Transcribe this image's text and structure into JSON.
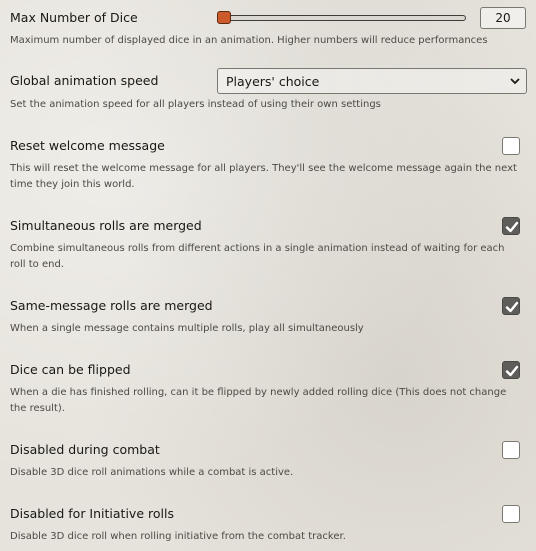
{
  "settings": [
    {
      "label": "Max Number of Dice",
      "hint": "Maximum number of displayed dice in an animation. Higher numbers will reduce performances",
      "control": "range",
      "value": "20"
    },
    {
      "label": "Global animation speed",
      "hint": "Set the animation speed for all players instead of using their own settings",
      "control": "select",
      "selected": "Players' choice"
    },
    {
      "label": "Reset welcome message",
      "hint": "This will reset the welcome message for all players. They'll see the welcome message again the next time they join this world.",
      "control": "checkbox",
      "checked": false
    },
    {
      "label": "Simultaneous rolls are merged",
      "hint": "Combine simultaneous rolls from different actions in a single animation instead of waiting for each roll to end.",
      "control": "checkbox",
      "checked": true
    },
    {
      "label": "Same-message rolls are merged",
      "hint": "When a single message contains multiple rolls, play all simultaneously",
      "control": "checkbox",
      "checked": true
    },
    {
      "label": "Dice can be flipped",
      "hint": "When a die has finished rolling, can it be flipped by newly added rolling dice (This does not change the result).",
      "control": "checkbox",
      "checked": true
    },
    {
      "label": "Disabled during combat",
      "hint": "Disable 3D dice roll animations while a combat is active.",
      "control": "checkbox",
      "checked": false
    },
    {
      "label": "Disabled for Initiative rolls",
      "hint": "Disable 3D dice roll when rolling initiative from the combat tracker.",
      "control": "checkbox",
      "checked": false
    }
  ],
  "colors": {
    "background": "#e6e3dc",
    "slider_handle": "#cc5a2a",
    "checkbox_checked": "#5e5d5a"
  },
  "icons": [
    "check-icon",
    "chevron-down-icon"
  ]
}
